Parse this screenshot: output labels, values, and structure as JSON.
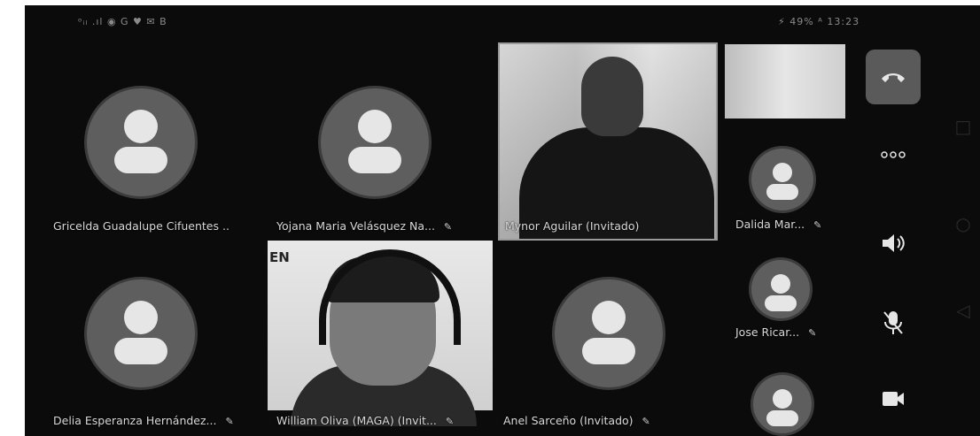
{
  "status_bar": {
    "left": "ᵒᵢₗ .ıl ◉ G ♥ ✉ B",
    "right": "⚡ 49% ᴬ 13:23"
  },
  "participants": [
    {
      "name": "Gricelda Guadalupe Cifuentes ..",
      "video": false,
      "muted": false
    },
    {
      "name": "Yojana Maria Velásquez Na...",
      "video": false,
      "muted": true
    },
    {
      "name": "Mynor Aguilar (Invitado)",
      "video": true,
      "muted": false,
      "active": true
    },
    {
      "name": "Dalida Mar...",
      "video": false,
      "muted": true
    },
    {
      "name": "Delia Esperanza Hernández...",
      "video": false,
      "muted": true
    },
    {
      "name": "William Oliva (MAGA) (Invit...",
      "video": true,
      "muted": true
    },
    {
      "name": "Anel Sarceño (Invitado)",
      "video": false,
      "muted": true
    },
    {
      "name": "Jose Ricar...",
      "video": false,
      "muted": true
    }
  ],
  "mic_off_glyph": "✎",
  "video_wall_text": "EN",
  "controls": {
    "end_call_icon": "phone-hangup-icon",
    "more_icon": "ellipsis-icon",
    "speaker_icon": "speaker-icon",
    "mute_icon": "mic-off-icon",
    "camera_icon": "camera-icon"
  },
  "nav": {
    "recents": "□",
    "home": "○",
    "back": "◁"
  },
  "colors": {
    "background": "#0b0b0b",
    "avatar": "#5e5e5e",
    "avatar_glyph": "#e6e6e6"
  }
}
